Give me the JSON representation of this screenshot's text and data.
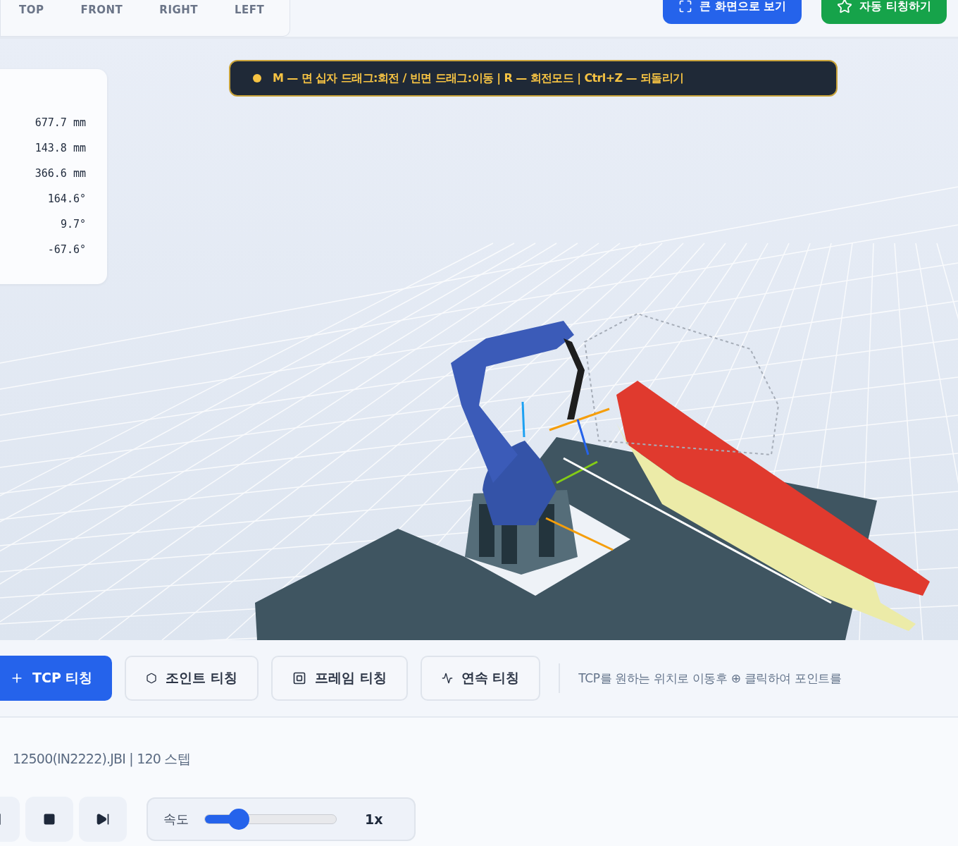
{
  "view_tabs": [
    {
      "label": "TOP"
    },
    {
      "label": "FRONT"
    },
    {
      "label": "RIGHT"
    },
    {
      "label": "LEFT"
    }
  ],
  "header_buttons": [
    {
      "label": "큰 화면으로 보기",
      "kind": "fullscreen"
    },
    {
      "label": "자동 티칭하기",
      "kind": "auto"
    }
  ],
  "hint_bar": {
    "text": "M — 면 십자 드래그:회전 / 빈면 드래그:이동 | R — 회전모드 | Ctrl+Z — 되돌리기"
  },
  "pose_readout": [
    "677.7 mm",
    "143.8 mm",
    "366.6 mm",
    "164.6°",
    "9.7°",
    "-67.6°"
  ],
  "teach_modes": [
    {
      "label": "TCP 티칭",
      "kind": "tcp",
      "selected": true
    },
    {
      "label": "조인트 티칭",
      "kind": "joint",
      "selected": false
    },
    {
      "label": "프레임 티칭",
      "kind": "frame",
      "selected": false
    },
    {
      "label": "연속 티칭",
      "kind": "continuous",
      "selected": false
    }
  ],
  "teach_hint": "TCP를 원하는 위치로 이동후 ⊕ 클릭하여 포인트를",
  "program": {
    "file_info": "12500(IN2222).JBI | 120 스텝"
  },
  "playback_buttons": [
    {
      "kind": "pause"
    },
    {
      "kind": "stop"
    },
    {
      "kind": "step"
    }
  ],
  "speed": {
    "label": "속도",
    "level": 0.26,
    "reading": "1x"
  }
}
